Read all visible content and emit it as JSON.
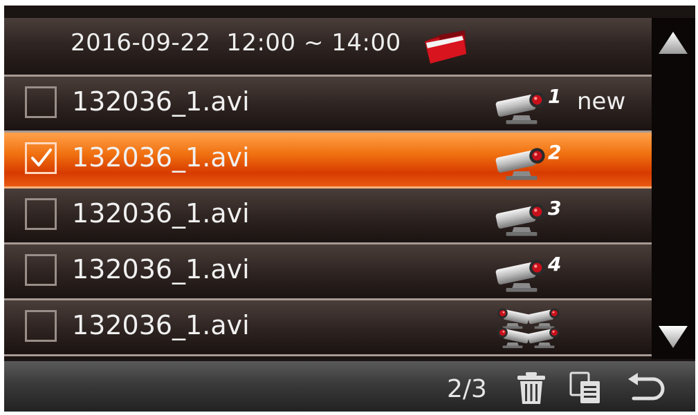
{
  "header": {
    "title": "2016-09-22  12:00 ~ 14:00",
    "folder_icon": "red-folder-icon"
  },
  "files": [
    {
      "name": "132036_1.avi",
      "checked": false,
      "camera": "1",
      "tag": "new",
      "selected": false
    },
    {
      "name": "132036_1.avi",
      "checked": true,
      "camera": "2",
      "tag": "",
      "selected": true
    },
    {
      "name": "132036_1.avi",
      "checked": false,
      "camera": "3",
      "tag": "",
      "selected": false
    },
    {
      "name": "132036_1.avi",
      "checked": false,
      "camera": "4",
      "tag": "",
      "selected": false
    },
    {
      "name": "132036_1.avi",
      "checked": false,
      "camera": "",
      "tag": "",
      "selected": false
    }
  ],
  "footer": {
    "page_indicator": "2/3",
    "icons": [
      "trash-icon",
      "copy-icon",
      "back-icon"
    ]
  },
  "scrollbar": {
    "icons": [
      "arrow-up-icon",
      "arrow-down-icon"
    ]
  },
  "colors": {
    "highlight": "#f07010",
    "camera_red": "#c8101a",
    "folder_red": "#c0121c"
  }
}
